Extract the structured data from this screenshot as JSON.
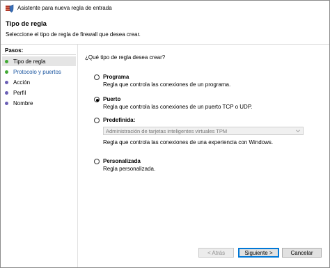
{
  "window": {
    "title": "Asistente para nueva regla de entrada",
    "icon": "firewall-shield-icon"
  },
  "header": {
    "title": "Tipo de regla",
    "subtitle": "Seleccione el tipo de regla de firewall que desea crear."
  },
  "steps": {
    "label": "Pasos:",
    "items": [
      {
        "label": "Tipo de regla",
        "state": "current",
        "dot_color": "#41a933"
      },
      {
        "label": "Protocolo y puertos",
        "state": "link",
        "dot_color": "#41a933"
      },
      {
        "label": "Acción",
        "state": "pending",
        "dot_color": "#6a5fb5"
      },
      {
        "label": "Perfil",
        "state": "pending",
        "dot_color": "#6a5fb5"
      },
      {
        "label": "Nombre",
        "state": "pending",
        "dot_color": "#6a5fb5"
      }
    ]
  },
  "main": {
    "question": "¿Qué tipo de regla desea crear?",
    "options": [
      {
        "title": "Programa",
        "description": "Regla que controla las conexiones de un programa.",
        "checked": false
      },
      {
        "title": "Puerto",
        "description": "Regla que controla las conexiones de un puerto TCP o UDP.",
        "checked": true
      },
      {
        "title": "Predefinida:",
        "description": "Regla que controla las conexiones de una experiencia con Windows.",
        "checked": false
      },
      {
        "title": "Personalizada",
        "description": "Regla personalizada.",
        "checked": false
      }
    ],
    "predefined_select": {
      "value": "Administración de tarjetas inteligentes virtuales TPM",
      "disabled": true
    }
  },
  "buttons": {
    "back": "< Atrás",
    "next": "Siguiente >",
    "cancel": "Cancelar"
  }
}
